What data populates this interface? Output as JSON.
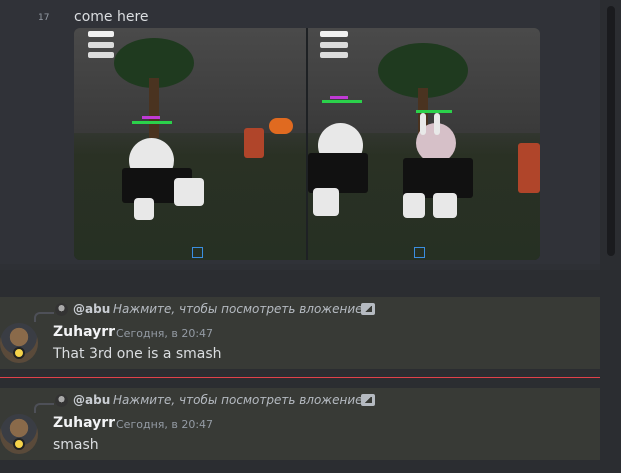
{
  "messages": [
    {
      "hover_time": "17",
      "text": "come here",
      "attachment": {
        "type": "image",
        "description_icons": [
          "game-screenshot-icon",
          "game-screenshot-icon"
        ]
      }
    },
    {
      "reply": {
        "username": "@abu",
        "text": "Нажмите, чтобы посмотреть вложение",
        "icon": "image-icon"
      },
      "author": "Zuhayrr",
      "timestamp": "Сегодня, в 20:47",
      "text": "That 3rd one is a smash"
    },
    {
      "reply": {
        "username": "@abu",
        "text": "Нажмите, чтобы посмотреть вложение",
        "icon": "image-icon"
      },
      "author": "Zuhayrr",
      "timestamp": "Сегодня, в 20:47",
      "text": "smash"
    }
  ],
  "colors": {
    "background": "#2b2d31",
    "highlight": "#383a36",
    "new_divider": "#e0414a",
    "username": "#f2f3f5",
    "timestamp": "#949ba4"
  }
}
